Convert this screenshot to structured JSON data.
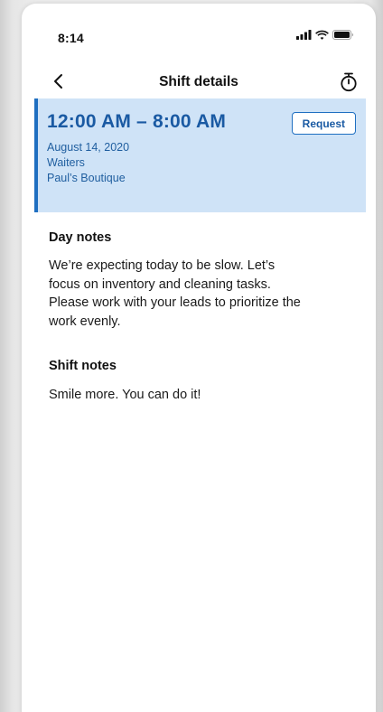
{
  "status_bar": {
    "time": "8:14"
  },
  "nav": {
    "title": "Shift details",
    "back_icon": "chevron-left-icon",
    "action_icon": "stopwatch-icon"
  },
  "shift": {
    "time_range": "12:00 AM – 8:00 AM",
    "date": "August 14, 2020",
    "role": "Waiters",
    "location": "Paul’s Boutique",
    "request_label": "Request"
  },
  "day_notes": {
    "title": "Day notes",
    "lines": [
      "We’re expecting today to be slow. Let’s",
      "focus on inventory and cleaning tasks.",
      "Please work with your leads to prioritize the",
      "work evenly."
    ]
  },
  "shift_notes": {
    "title": "Shift notes",
    "text": "Smile more. You can do it!"
  },
  "colors": {
    "card_background": "#cfe3f7",
    "accent": "#1f6fc1",
    "accent_text": "#1a5aa3"
  }
}
